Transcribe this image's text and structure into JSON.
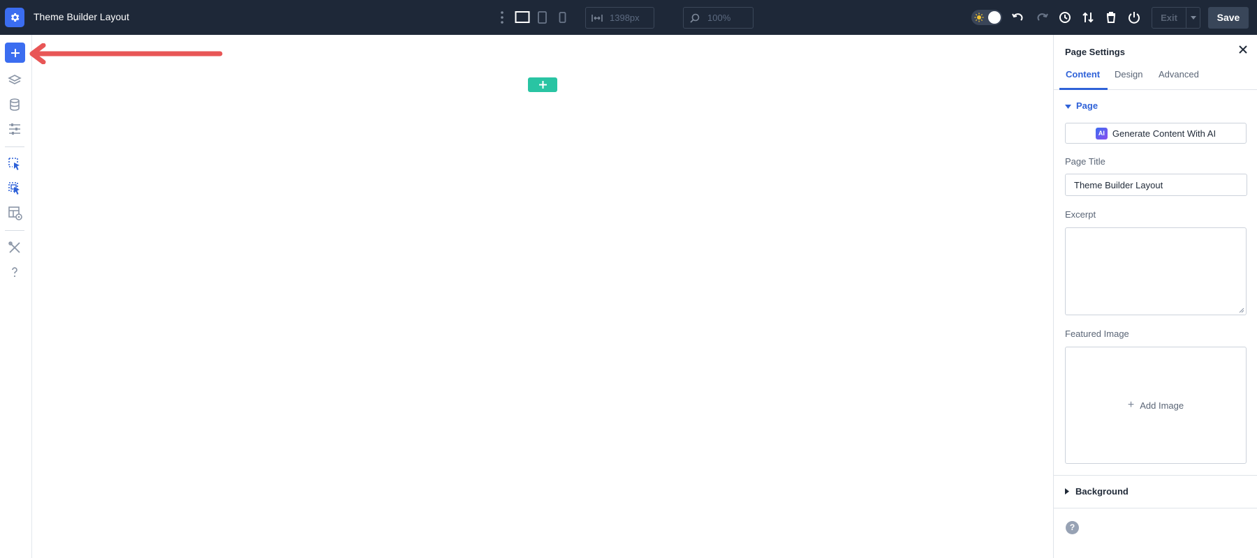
{
  "topbar": {
    "title": "Theme Builder Layout",
    "width_value": "1398px",
    "zoom_value": "100%",
    "exit_label": "Exit",
    "save_label": "Save"
  },
  "colors": {
    "topbar_bg": "#1e2838",
    "accent_blue": "#3b6df0",
    "section_add_green": "#29c4a3",
    "arrow_red": "#e85656",
    "tab_active": "#2f62d8"
  },
  "rail": {
    "icons": [
      "plus-icon",
      "layers-icon",
      "database-icon",
      "sliders-icon",
      "select-cursor-icon",
      "select-multi-cursor-icon",
      "layout-view-icon",
      "tools-icon",
      "help-icon"
    ]
  },
  "panel": {
    "title": "Page Settings",
    "tabs": [
      {
        "label": "Content",
        "active": true
      },
      {
        "label": "Design",
        "active": false
      },
      {
        "label": "Advanced",
        "active": false
      }
    ],
    "page_section": "Page",
    "ai_button": "Generate Content With AI",
    "ai_badge": "AI",
    "page_title_label": "Page Title",
    "page_title_value": "Theme Builder Layout",
    "excerpt_label": "Excerpt",
    "featured_label": "Featured Image",
    "add_image": "Add Image",
    "background_section": "Background",
    "help": "?"
  }
}
